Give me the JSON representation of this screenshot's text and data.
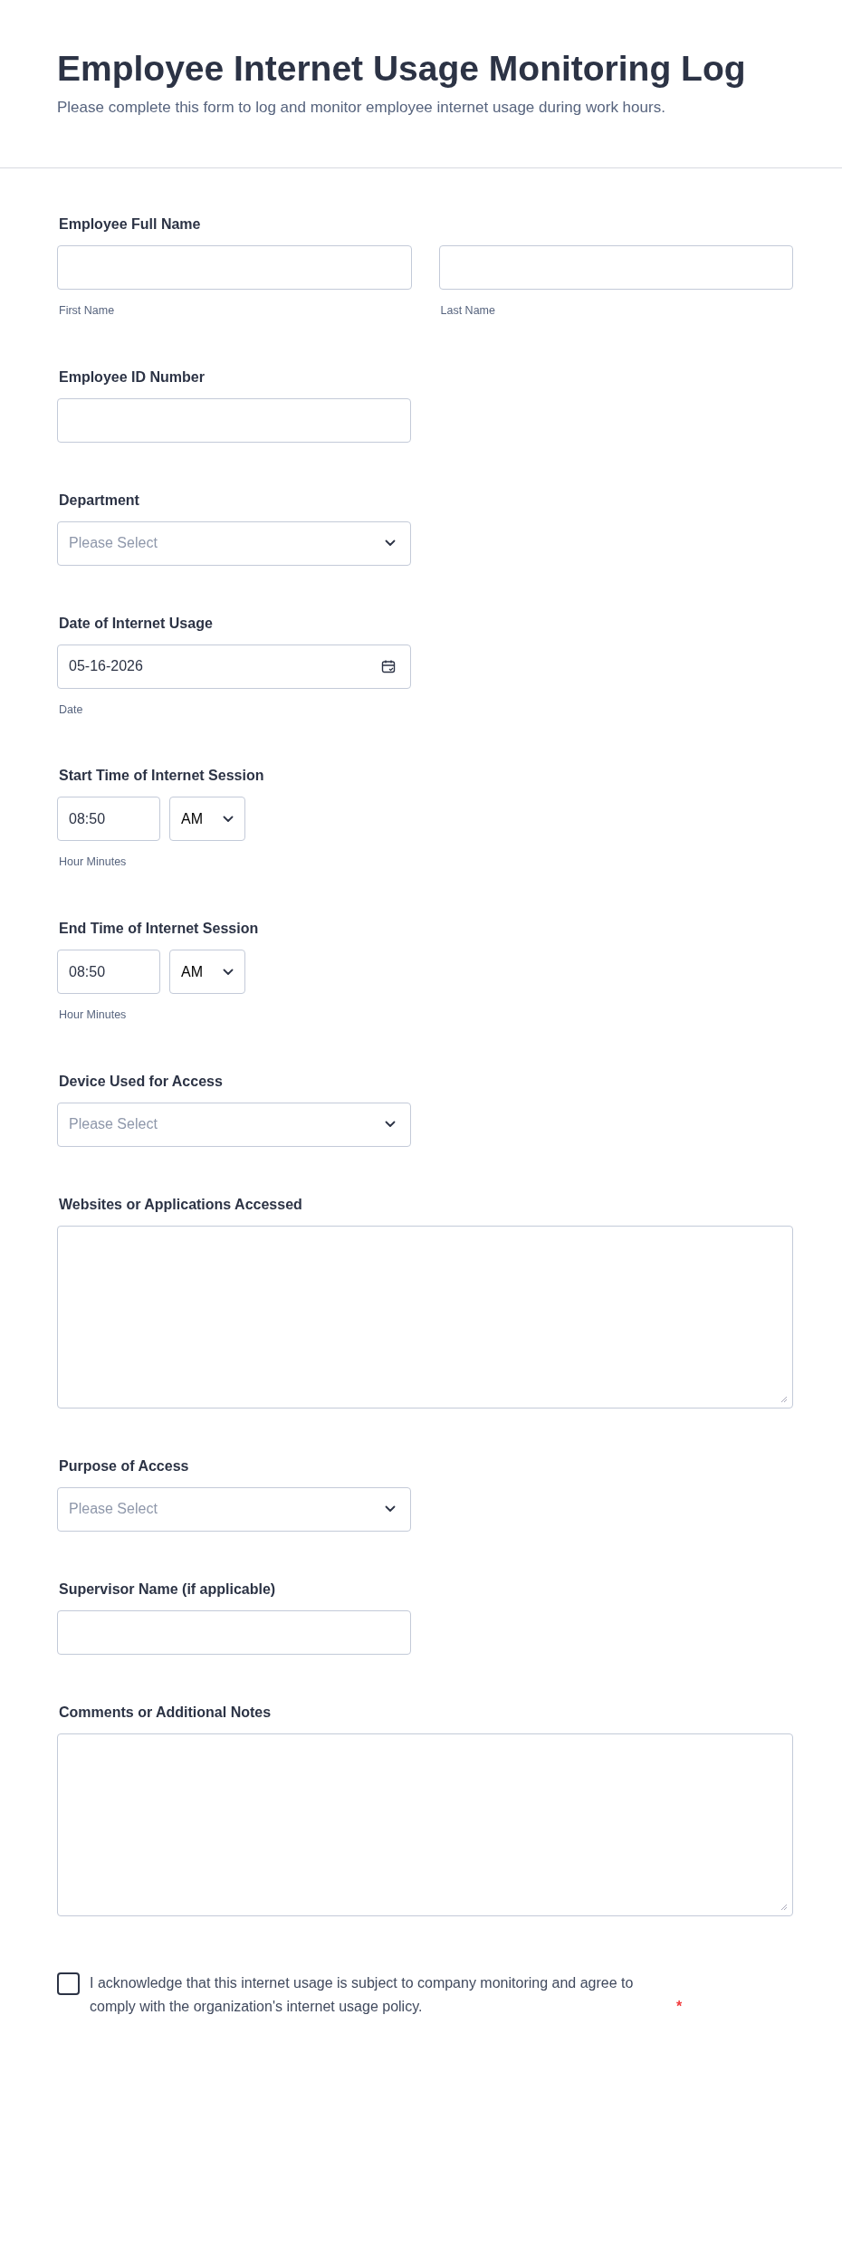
{
  "header": {
    "title": "Employee Internet Usage Monitoring Log",
    "description": "Please complete this form to log and monitor employee internet usage during work hours."
  },
  "fields": [
    {
      "kind": "name_pair",
      "label": "Employee Full Name",
      "sublabels": [
        "First Name",
        "Last Name"
      ]
    },
    {
      "kind": "text",
      "label": "Employee ID Number"
    },
    {
      "kind": "select",
      "label": "Department",
      "placeholder": "Please Select"
    },
    {
      "kind": "date",
      "label": "Date of Internet Usage",
      "value": "05-16-2026",
      "sublabel": "Date"
    },
    {
      "kind": "time",
      "label": "Start Time of Internet Session",
      "value": "08:50",
      "period": "AM",
      "sublabel": "Hour Minutes"
    },
    {
      "kind": "time",
      "label": "End Time of Internet Session",
      "value": "08:50",
      "period": "AM",
      "sublabel": "Hour Minutes"
    },
    {
      "kind": "select",
      "label": "Device Used for Access",
      "placeholder": "Please Select"
    },
    {
      "kind": "textarea",
      "label": "Websites or Applications Accessed"
    },
    {
      "kind": "select",
      "label": "Purpose of Access",
      "placeholder": "Please Select"
    },
    {
      "kind": "text",
      "label": "Supervisor Name (if applicable)"
    },
    {
      "kind": "textarea",
      "label": "Comments or Additional Notes"
    }
  ],
  "consent": {
    "text": "I acknowledge that this internet usage is subject to company monitoring and agree to comply with the organization's internet usage policy.",
    "required_mark": "*",
    "checked": false
  }
}
